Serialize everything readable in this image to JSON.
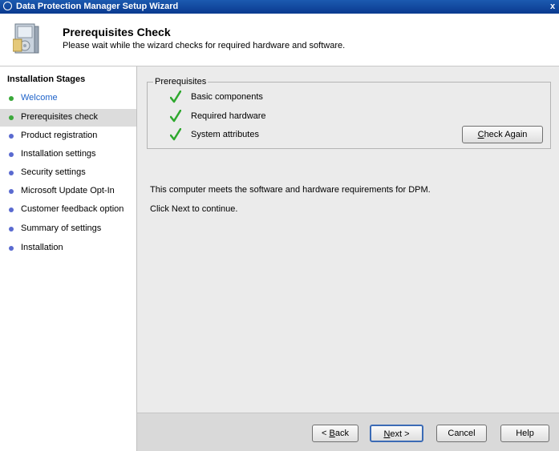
{
  "window": {
    "title": "Data Protection Manager Setup Wizard",
    "close_glyph": "x"
  },
  "header": {
    "title": "Prerequisites Check",
    "subtitle": "Please wait while the wizard checks for required hardware and software.",
    "icon": "setup-box-icon"
  },
  "sidebar": {
    "heading": "Installation Stages",
    "items": [
      {
        "label": "Welcome",
        "state": "completed",
        "dot_color": "#3aa83a"
      },
      {
        "label": "Prerequisites check",
        "state": "current",
        "dot_color": "#3aa83a"
      },
      {
        "label": "Product registration",
        "state": "pending",
        "dot_color": "#5a6ad0"
      },
      {
        "label": "Installation settings",
        "state": "pending",
        "dot_color": "#5a6ad0"
      },
      {
        "label": "Security settings",
        "state": "pending",
        "dot_color": "#5a6ad0"
      },
      {
        "label": "Microsoft Update Opt-In",
        "state": "pending",
        "dot_color": "#5a6ad0"
      },
      {
        "label": "Customer feedback option",
        "state": "pending",
        "dot_color": "#5a6ad0"
      },
      {
        "label": "Summary of settings",
        "state": "pending",
        "dot_color": "#5a6ad0"
      },
      {
        "label": "Installation",
        "state": "pending",
        "dot_color": "#5a6ad0"
      }
    ]
  },
  "main": {
    "group_label": "Prerequisites",
    "prerequisites": [
      {
        "label": "Basic components",
        "status": "passed"
      },
      {
        "label": "Required hardware",
        "status": "passed"
      },
      {
        "label": "System attributes",
        "status": "passed"
      }
    ],
    "check_again": {
      "pre": "",
      "accel": "C",
      "post": "heck Again"
    },
    "message_1": "This computer meets the software and hardware requirements for DPM.",
    "message_2": "Click Next to continue."
  },
  "footer": {
    "back": {
      "pre": "< ",
      "accel": "B",
      "post": "ack"
    },
    "next": {
      "pre": "",
      "accel": "N",
      "post": "ext >"
    },
    "cancel": "Cancel",
    "help": "Help"
  },
  "colors": {
    "title_bar": "#0a3a8f",
    "link": "#1e62c9",
    "check": "#2ea82e",
    "panel": "#ebebeb"
  }
}
